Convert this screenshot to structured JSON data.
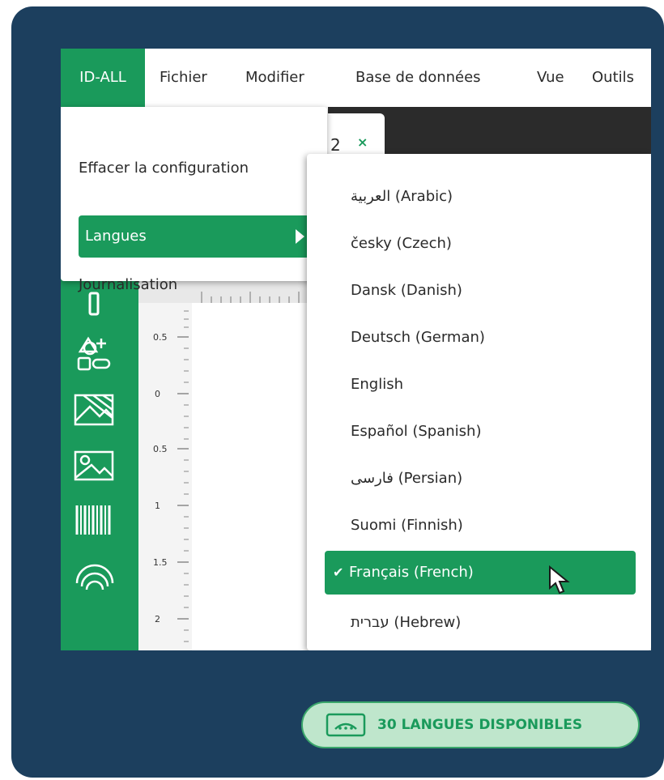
{
  "menubar": {
    "items": [
      "ID-ALL",
      "Fichier",
      "Modifier",
      "Base de données",
      "Vue",
      "Outils"
    ]
  },
  "tab": {
    "label": "2",
    "close": "×"
  },
  "app_menu": {
    "items": [
      {
        "label": "Effacer la configuration"
      },
      {
        "label": "Langues"
      },
      {
        "label": "Journalisation"
      }
    ]
  },
  "languages": {
    "items": [
      "العربية (Arabic)",
      "česky (Czech)",
      "Dansk (Danish)",
      "Deutsch (German)",
      "English",
      "Español (Spanish)",
      "فارسی (Persian)",
      "Suomi (Finnish)",
      "Français (French)",
      "עברית (Hebrew)"
    ],
    "selected_index": 8,
    "check": "✔"
  },
  "ruler": {
    "labels": [
      "0.5",
      "0",
      "0.5",
      "1",
      "1.5",
      "2"
    ]
  },
  "tools": [
    "text-tool-icon",
    "shapes-tool-icon",
    "hatched-image-icon",
    "image-icon",
    "barcode-icon",
    "fingerprint-icon"
  ],
  "badge": {
    "text": "30 LANGUES DISPONIBLES",
    "icon": "speech-bubble-icon"
  },
  "colors": {
    "accent": "#1a9a5b",
    "frame": "#1c3f5e",
    "badge_bg": "#bfe6cc"
  }
}
